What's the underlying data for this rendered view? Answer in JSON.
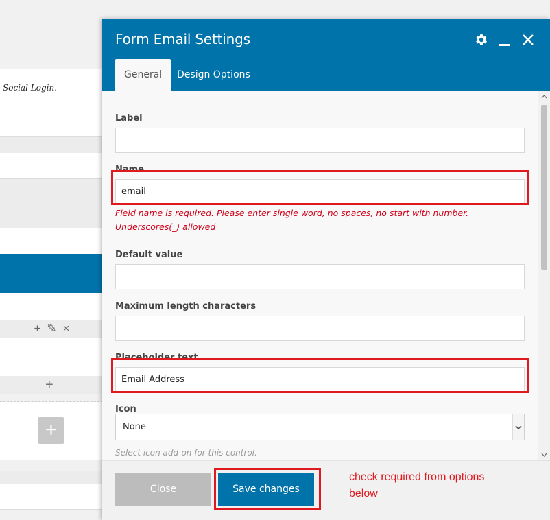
{
  "background": {
    "social_login_text": "Social Login.",
    "row_tools": {
      "add_icon": "+",
      "edit_icon": "✎",
      "remove_icon": "×"
    },
    "add_small_icon": "+",
    "add_box_icon": "+"
  },
  "modal": {
    "title": "Form Email Settings",
    "header_icons": [
      "gear-icon",
      "minimize-icon",
      "close-icon"
    ],
    "tabs": [
      {
        "label": "General",
        "active": true
      },
      {
        "label": "Design Options",
        "active": false
      }
    ],
    "fields": {
      "label": {
        "label": "Label",
        "value": ""
      },
      "name": {
        "label": "Name",
        "value": "email",
        "error": "Field name is required. Please enter single word, no spaces, no start with number. Underscores(_) allowed"
      },
      "default_value": {
        "label": "Default value",
        "value": ""
      },
      "max_length": {
        "label": "Maximum length characters",
        "value": ""
      },
      "placeholder": {
        "label": "Placeholder text",
        "value": "Email Address"
      },
      "icon": {
        "label": "Icon",
        "selected": "None",
        "hint": "Select icon add-on for this control."
      }
    },
    "footer": {
      "close_label": "Close",
      "save_label": "Save changes",
      "note": "check required from options below"
    }
  },
  "colors": {
    "brand_blue": "#0073aa",
    "annotation_red": "#e0191f",
    "error_red": "#d0021b"
  }
}
